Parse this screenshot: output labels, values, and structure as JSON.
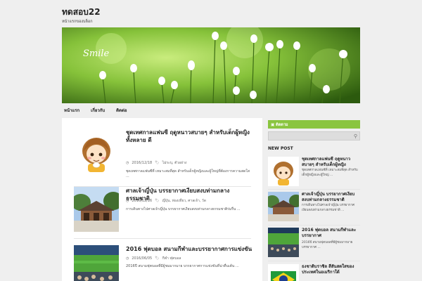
{
  "site": {
    "title": "ทดสอบ22",
    "description": "หน้าแรกของบล็อก",
    "logo_text": "Smile"
  },
  "nav": {
    "items": [
      "หน้าแรก",
      "เกี่ยวกับ",
      "ติดต่อ"
    ]
  },
  "posts": [
    {
      "title": "ชุดเทศกาลแฟนซี ฤดูหนาวสบายๆ สำหรับเด็กผู้หญิงทั้งหลาย ดี",
      "date": "2016/12/18",
      "tags": "ไม่ระบุ, ตัวอย่าง",
      "excerpt": "ชุดเทศกาลแฟนซีที่ เหมาะสมที่สุด สำหรับเด็กผู้หญิงและผู้ใหญ่ที่ต้องการความสดใส ..."
    },
    {
      "title": "ศาลเจ้าญี่ปุ่น บรรยากาศเงียบสงบท่ามกลางธรรมชาติ",
      "date": "2016/12/16",
      "tags": "ญี่ปุ่น, ท่องเที่ยว, ศาลเจ้า, วัด",
      "excerpt": "การเดินทางไปศาลเจ้าญี่ปุ่น บรรยากาศเงียบสงบท่ามกลางธรรมชาติร่มรื่น ..."
    },
    {
      "title": "2016 ฟุตบอล สนามกีฬาและบรรยากาศการแข่งขัน",
      "date": "2016/06/05",
      "tags": "กีฬา ฟุตบอล",
      "excerpt": "2016ปี สนามฟุตบอลที่มีผู้ชมมากมาย บรรยากาศการแข่งขันที่น่าตื่นเต้น ..."
    }
  ],
  "sidebar": {
    "rss_label": "ติดตาม",
    "search_placeholder": "",
    "new_post_title": "NEW POST",
    "new_posts": [
      {
        "title": "ชุดเทศกาลแฟนซี ฤดูหนาวสบายๆ สำหรับเด็กผู้หญิง",
        "excerpt": "ชุดเทศกาลแฟนซีที่ เหมาะสมที่สุด สำหรับเด็กผู้หญิงและผู้ใหญ่ ..."
      },
      {
        "title": "ศาลเจ้าญี่ปุ่น บรรยากาศเงียบสงบท่ามกลางธรรมชาติ",
        "excerpt": "การเดินทางไปศาลเจ้าญี่ปุ่น บรรยากาศเงียบสงบท่ามกลางธรรมชาติ ..."
      },
      {
        "title": "2016 ฟุตบอล สนามกีฬาและบรรยากาศ",
        "excerpt": "2016ปี สนามฟุตบอลที่มีผู้ชมมากมาย บรรยากาศ ..."
      },
      {
        "title": "ธงชาติบราซิล สีสันสดใสของประเทศในอเมริกาใต้",
        "excerpt": ""
      }
    ]
  },
  "colors": {
    "accent": "#8ac53f",
    "background": "#efefef"
  }
}
